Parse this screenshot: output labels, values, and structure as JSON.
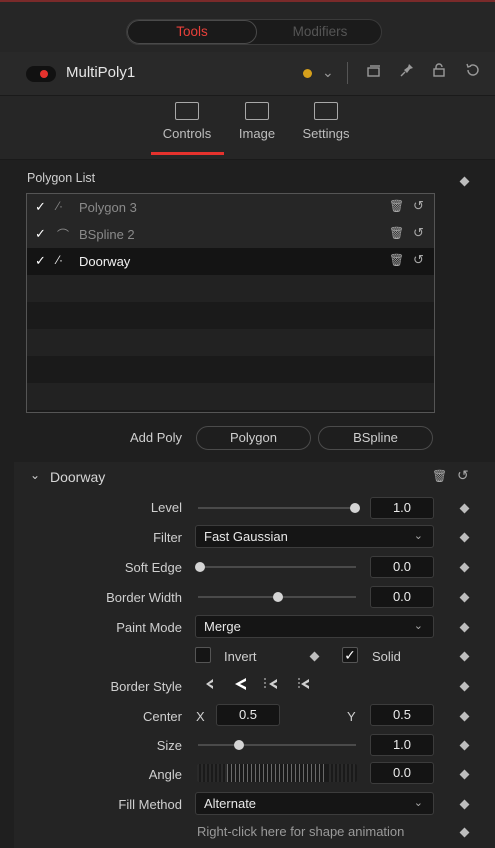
{
  "topbar": {
    "tools_label": "Tools",
    "modifiers_label": "Modifiers"
  },
  "header": {
    "tool_name": "MultiPoly1",
    "color_dot": "#d59f1b"
  },
  "tabs": [
    {
      "label": "Controls",
      "active": true
    },
    {
      "label": "Image",
      "active": false
    },
    {
      "label": "Settings",
      "active": false
    }
  ],
  "polygon_list": {
    "label": "Polygon List",
    "items": [
      {
        "label": "Polygon 3",
        "checked": "✓",
        "selected": false
      },
      {
        "label": "BSpline 2",
        "checked": "✓",
        "selected": false
      },
      {
        "label": "Doorway",
        "checked": "✓",
        "selected": true
      }
    ]
  },
  "add_poly": {
    "label": "Add Poly",
    "polygon_button": "Polygon",
    "bspline_button": "BSpline"
  },
  "panel": {
    "title": "Doorway",
    "level": {
      "label": "Level",
      "value": "1.0",
      "fraction": 1.0
    },
    "filter": {
      "label": "Filter",
      "value": "Fast Gaussian"
    },
    "soft_edge": {
      "label": "Soft Edge",
      "value": "0.0",
      "fraction": 0.0
    },
    "border_width": {
      "label": "Border Width",
      "value": "0.0",
      "fraction": 0.5
    },
    "paint_mode": {
      "label": "Paint Mode",
      "value": "Merge"
    },
    "invert": {
      "label": "Invert",
      "checked": false
    },
    "solid": {
      "label": "Solid",
      "checked": true,
      "mark": "✓"
    },
    "border_style": {
      "label": "Border Style"
    },
    "center": {
      "label": "Center",
      "x_label": "X",
      "x_value": "0.5",
      "y_label": "Y",
      "y_value": "0.5"
    },
    "size": {
      "label": "Size",
      "value": "1.0",
      "fraction": 0.25
    },
    "angle": {
      "label": "Angle",
      "value": "0.0"
    },
    "fill_method": {
      "label": "Fill Method",
      "value": "Alternate"
    },
    "hint": "Right-click here for shape animation"
  },
  "colors": {
    "accent": "#e5322d",
    "background": "#1f1f1f"
  }
}
